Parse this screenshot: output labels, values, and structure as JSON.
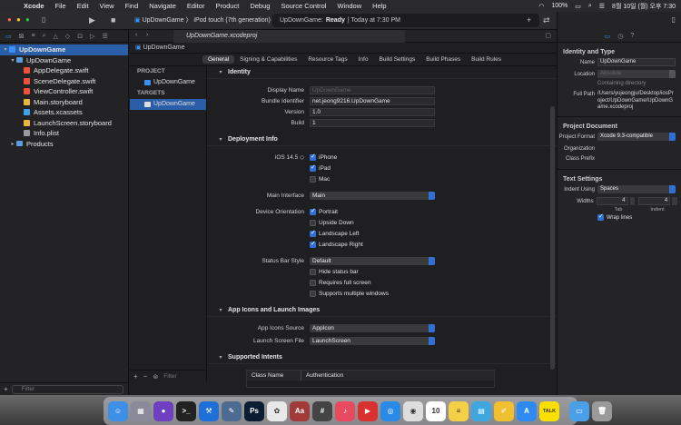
{
  "menubar": {
    "apple": "",
    "items": [
      "Xcode",
      "File",
      "Edit",
      "View",
      "Find",
      "Navigate",
      "Editor",
      "Product",
      "Debug",
      "Source Control",
      "Window",
      "Help"
    ],
    "battery": "100%",
    "datetime": "8월 10일 (월) 오후 7:30"
  },
  "toolbar": {
    "scheme": "UpDownGame",
    "separator": "〉",
    "device": "iPod touch (7th generation)",
    "status_project": "UpDownGame:",
    "status_state": "Ready",
    "status_time": "| Today at 7:30 PM"
  },
  "navigator": {
    "items": [
      {
        "label": "UpDownGame",
        "indent": 0,
        "icon": "proj",
        "tri": "▾",
        "selected": true
      },
      {
        "label": "UpDownGame",
        "indent": 1,
        "icon": "folder",
        "tri": "▾"
      },
      {
        "label": "AppDelegate.swift",
        "indent": 2,
        "icon": "swift"
      },
      {
        "label": "SceneDelegate.swift",
        "indent": 2,
        "icon": "swift"
      },
      {
        "label": "ViewController.swift",
        "indent": 2,
        "icon": "swift"
      },
      {
        "label": "Main.storyboard",
        "indent": 2,
        "icon": "sb"
      },
      {
        "label": "Assets.xcassets",
        "indent": 2,
        "icon": "assets"
      },
      {
        "label": "LaunchScreen.storyboard",
        "indent": 2,
        "icon": "sb"
      },
      {
        "label": "Info.plist",
        "indent": 2,
        "icon": "plist"
      },
      {
        "label": "Products",
        "indent": 1,
        "icon": "folder",
        "tri": "▸"
      }
    ],
    "filter_placeholder": "Filter"
  },
  "editor": {
    "tab_title": "UpDownGame.xcodeproj",
    "jump": "UpDownGame",
    "segments": [
      "General",
      "Signing & Capabilities",
      "Resource Tags",
      "Info",
      "Build Settings",
      "Build Phases",
      "Build Rules"
    ],
    "project_header": "PROJECT",
    "project_item": "UpDownGame",
    "targets_header": "TARGETS",
    "target_item": "UpDownGame",
    "filter_placeholder": "Filter"
  },
  "identity": {
    "title": "Identity",
    "display_name_label": "Display Name",
    "display_name_placeholder": "UpDownGame",
    "bundle_id_label": "Bundle Identifier",
    "bundle_id": "net.jeong9216.UpDownGame",
    "version_label": "Version",
    "version": "1.0",
    "build_label": "Build",
    "build": "1"
  },
  "deployment": {
    "title": "Deployment Info",
    "ios_version": "iOS 14.5 ◇",
    "iphone": "iPhone",
    "ipad": "iPad",
    "mac": "Mac",
    "main_interface_label": "Main Interface",
    "main_interface": "Main",
    "orientation_label": "Device Orientation",
    "portrait": "Portrait",
    "upside_down": "Upside Down",
    "landscape_left": "Landscape Left",
    "landscape_right": "Landscape Right",
    "status_bar_label": "Status Bar Style",
    "status_bar": "Default",
    "hide_status": "Hide status bar",
    "requires_full": "Requires full screen",
    "multiple_windows": "Supports multiple windows"
  },
  "app_icons": {
    "title": "App Icons and Launch Images",
    "source_label": "App Icons Source",
    "source": "AppIcon",
    "launch_label": "Launch Screen File",
    "launch": "LaunchScreen"
  },
  "intents": {
    "title": "Supported Intents",
    "col1": "Class Name",
    "col2": "Authentication"
  },
  "inspector": {
    "identity_title": "Identity and Type",
    "name_label": "Name",
    "name": "UpDownGame",
    "location_label": "Location",
    "location": "Absolute",
    "containing": "Containing directory",
    "fullpath_label": "Full Path",
    "fullpath": "/Users/yujeongju/Desktop/iosProject/UpDownGame/UpDownGame.xcodeproj",
    "doc_title": "Project Document",
    "format_label": "Project Format",
    "format": "Xcode 9.3-compatible",
    "org_label": "Organization",
    "prefix_label": "Class Prefix",
    "text_title": "Text Settings",
    "indent_label": "Indent Using",
    "indent": "Spaces",
    "widths_label": "Widths",
    "tab_width": "4",
    "indent_width": "4",
    "tab_sub": "Tab",
    "indent_sub": "Indent",
    "wrap": "Wrap lines"
  },
  "dock": [
    {
      "name": "finder-icon",
      "color": "#3d8fe8",
      "glyph": "☺"
    },
    {
      "name": "launchpad-icon",
      "color": "#8a8a9a",
      "glyph": "▦"
    },
    {
      "name": "github-icon",
      "color": "#6e3fc1",
      "glyph": "●"
    },
    {
      "name": "terminal-icon",
      "color": "#222222",
      "glyph": ">_"
    },
    {
      "name": "xcode-icon",
      "color": "#1f6fd8",
      "glyph": "⚒"
    },
    {
      "name": "notes-icon",
      "color": "#4d6a90",
      "glyph": "✎"
    },
    {
      "name": "photoshop-icon",
      "color": "#0b1d33",
      "glyph": "Ps"
    },
    {
      "name": "photos-icon",
      "color": "#e8e8e8",
      "glyph": "✿"
    },
    {
      "name": "dictionary-icon",
      "color": "#a23a3a",
      "glyph": "Aa"
    },
    {
      "name": "calculator-icon",
      "color": "#444444",
      "glyph": "#"
    },
    {
      "name": "music-icon",
      "color": "#e84a5f",
      "glyph": "♪"
    },
    {
      "name": "bear-icon",
      "color": "#d93030",
      "glyph": "▶"
    },
    {
      "name": "safari-icon",
      "color": "#2a8ae8",
      "glyph": "◎"
    },
    {
      "name": "chrome-icon",
      "color": "#dddddd",
      "glyph": "◉"
    },
    {
      "name": "calendar-icon",
      "color": "#ffffff",
      "glyph": "10"
    },
    {
      "name": "notes-app-icon",
      "color": "#f3d046",
      "glyph": "≡"
    },
    {
      "name": "stacks-icon",
      "color": "#3fa7e0",
      "glyph": "▤"
    },
    {
      "name": "pencil-icon",
      "color": "#f0c030",
      "glyph": "✐"
    },
    {
      "name": "appstore-icon",
      "color": "#2d8af0",
      "glyph": "A"
    },
    {
      "name": "kakaotalk-icon",
      "color": "#f9e000",
      "glyph": "TALK"
    },
    {
      "name": "folder-icon",
      "color": "#4aa0e8",
      "glyph": "▭"
    },
    {
      "name": "trash-icon",
      "color": "#9a9a9a",
      "glyph": "🗑"
    }
  ]
}
